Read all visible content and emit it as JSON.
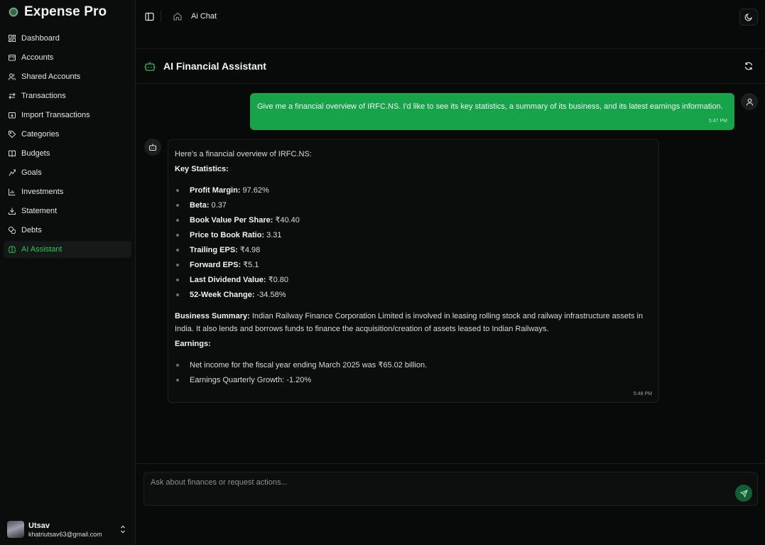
{
  "app": {
    "name": "Expense Pro"
  },
  "sidebar": {
    "items": [
      {
        "label": "Dashboard",
        "icon": "dashboard-icon"
      },
      {
        "label": "Accounts",
        "icon": "wallet-icon"
      },
      {
        "label": "Shared Accounts",
        "icon": "users-icon"
      },
      {
        "label": "Transactions",
        "icon": "arrows-icon"
      },
      {
        "label": "Import Transactions",
        "icon": "import-icon"
      },
      {
        "label": "Categories",
        "icon": "tag-icon"
      },
      {
        "label": "Budgets",
        "icon": "book-icon"
      },
      {
        "label": "Goals",
        "icon": "goal-icon"
      },
      {
        "label": "Investments",
        "icon": "chart-icon"
      },
      {
        "label": "Statement",
        "icon": "download-icon"
      },
      {
        "label": "Debts",
        "icon": "coins-icon"
      },
      {
        "label": "AI Assistant",
        "icon": "brain-icon",
        "active": true
      }
    ],
    "user": {
      "name": "Utsav",
      "email": "khatriutsav63@gmail.com"
    }
  },
  "header": {
    "breadcrumb": "Ai Chat"
  },
  "chat": {
    "title": "AI Financial Assistant",
    "user_message": {
      "text": "Give me a financial overview of IRFC.NS. I'd like to see its key statistics, a summary of its business, and its latest earnings information.",
      "time": "5:47 PM"
    },
    "bot_message": {
      "intro": "Here's a financial overview of IRFC.NS:",
      "key_stats_heading": "Key Statistics:",
      "key_stats": [
        {
          "label": "Profit Margin:",
          "value": "97.62%"
        },
        {
          "label": "Beta:",
          "value": "0.37"
        },
        {
          "label": "Book Value Per Share:",
          "value": "₹40.40"
        },
        {
          "label": "Price to Book Ratio:",
          "value": "3.31"
        },
        {
          "label": "Trailing EPS:",
          "value": "₹4.98"
        },
        {
          "label": "Forward EPS:",
          "value": "₹5.1"
        },
        {
          "label": "Last Dividend Value:",
          "value": "₹0.80"
        },
        {
          "label": "52-Week Change:",
          "value": "-34.58%"
        }
      ],
      "summary_label": "Business Summary:",
      "summary_text": "Indian Railway Finance Corporation Limited is involved in leasing rolling stock and railway infrastructure assets in India. It also lends and borrows funds to finance the acquisition/creation of assets leased to Indian Railways.",
      "earnings_heading": "Earnings:",
      "earnings": [
        "Net income for the fiscal year ending March 2025 was ₹65.02 billion.",
        "Earnings Quarterly Growth: -1.20%"
      ],
      "time": "5:48 PM"
    },
    "input": {
      "placeholder": "Ask about finances or request actions..."
    }
  },
  "colors": {
    "accent": "#16a34a",
    "active_text": "#22c55e",
    "background": "#080a09"
  }
}
